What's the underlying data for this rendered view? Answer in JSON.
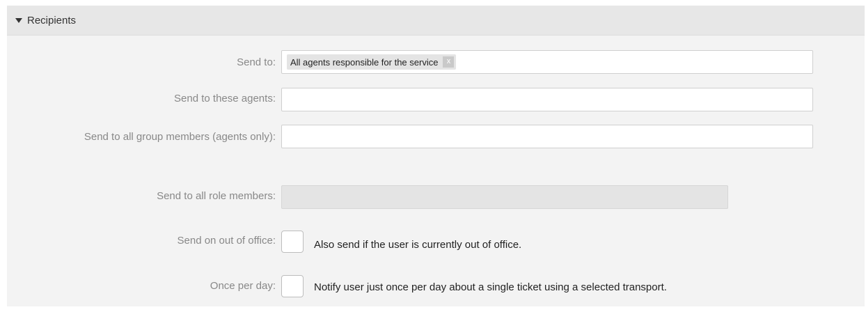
{
  "section": {
    "title": "Recipients"
  },
  "fields": {
    "send_to": {
      "label": "Send to:",
      "tokens": [
        {
          "text": "All agents responsible for the service",
          "remove": "x"
        }
      ]
    },
    "send_to_agents": {
      "label": "Send to these agents:",
      "value": ""
    },
    "send_to_groups": {
      "label": "Send to all group members (agents only):",
      "value": ""
    },
    "send_to_roles": {
      "label": "Send to all role members:",
      "value": "",
      "disabled": true
    },
    "out_of_office": {
      "label": "Send on out of office:",
      "checkbox_label": "Also send if the user is currently out of office.",
      "checked": false
    },
    "once_per_day": {
      "label": "Once per day:",
      "checkbox_label": "Notify user just once per day about a single ticket using a selected transport.",
      "checked": false
    }
  }
}
